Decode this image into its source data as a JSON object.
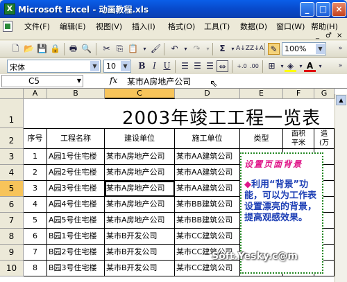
{
  "window": {
    "title": "Microsoft Excel - 动画教程.xls",
    "app_icon_letter": "X"
  },
  "menu": {
    "items": [
      "文件(F)",
      "编辑(E)",
      "视图(V)",
      "插入(I)",
      "格式(O)",
      "工具(T)",
      "数据(D)",
      "窗口(W)",
      "帮助(H)"
    ],
    "mdi": [
      "_",
      "♂",
      "×"
    ]
  },
  "toolbar": {
    "zoom": "100%",
    "font": "宋体",
    "size": "10",
    "bold": "B",
    "italic": "I",
    "underline": "U",
    "sum": "Σ"
  },
  "formula": {
    "cell_ref": "C5",
    "fx": "fx",
    "content": "某市A房地产公司"
  },
  "sheet": {
    "columns": [
      "A",
      "B",
      "C",
      "D",
      "E",
      "F",
      "G"
    ],
    "rows": [
      "1",
      "2",
      "3",
      "4",
      "5",
      "6",
      "7",
      "8",
      "9",
      "10"
    ],
    "title": "2003年竣工工程一览表",
    "headers": [
      "序号",
      "工程名称",
      "建设单位",
      "施工单位",
      "类型",
      "面积\n平米",
      "造\n(万"
    ],
    "data": [
      [
        "1",
        "A园1号住宅楼",
        "某市A房地产公司",
        "某市AA建筑公司"
      ],
      [
        "2",
        "A园2号住宅楼",
        "某市A房地产公司",
        "某市AA建筑公司"
      ],
      [
        "3",
        "A园3号住宅楼",
        "某市A房地产公司",
        "某市AA建筑公司"
      ],
      [
        "4",
        "A园4号住宅楼",
        "某市A房地产公司",
        "某市BB建筑公司"
      ],
      [
        "5",
        "A园5号住宅楼",
        "某市A房地产公司",
        "某市BB建筑公司"
      ],
      [
        "6",
        "B园1号住宅楼",
        "某市B开发公司",
        "某市CC建筑公司"
      ],
      [
        "7",
        "B园2号住宅楼",
        "某市B开发公司",
        "某市CC建筑公司"
      ],
      [
        "8",
        "B园3号住宅楼",
        "某市B开发公司",
        "某市CC建筑公司"
      ]
    ]
  },
  "note": {
    "title": "设置页面背景",
    "body_mark": "◆",
    "body": "利用“背景”功能，可以为工作表设置漂亮的背景，提高观感效果。"
  },
  "watermark": "Soft.Yesky.c@m"
}
